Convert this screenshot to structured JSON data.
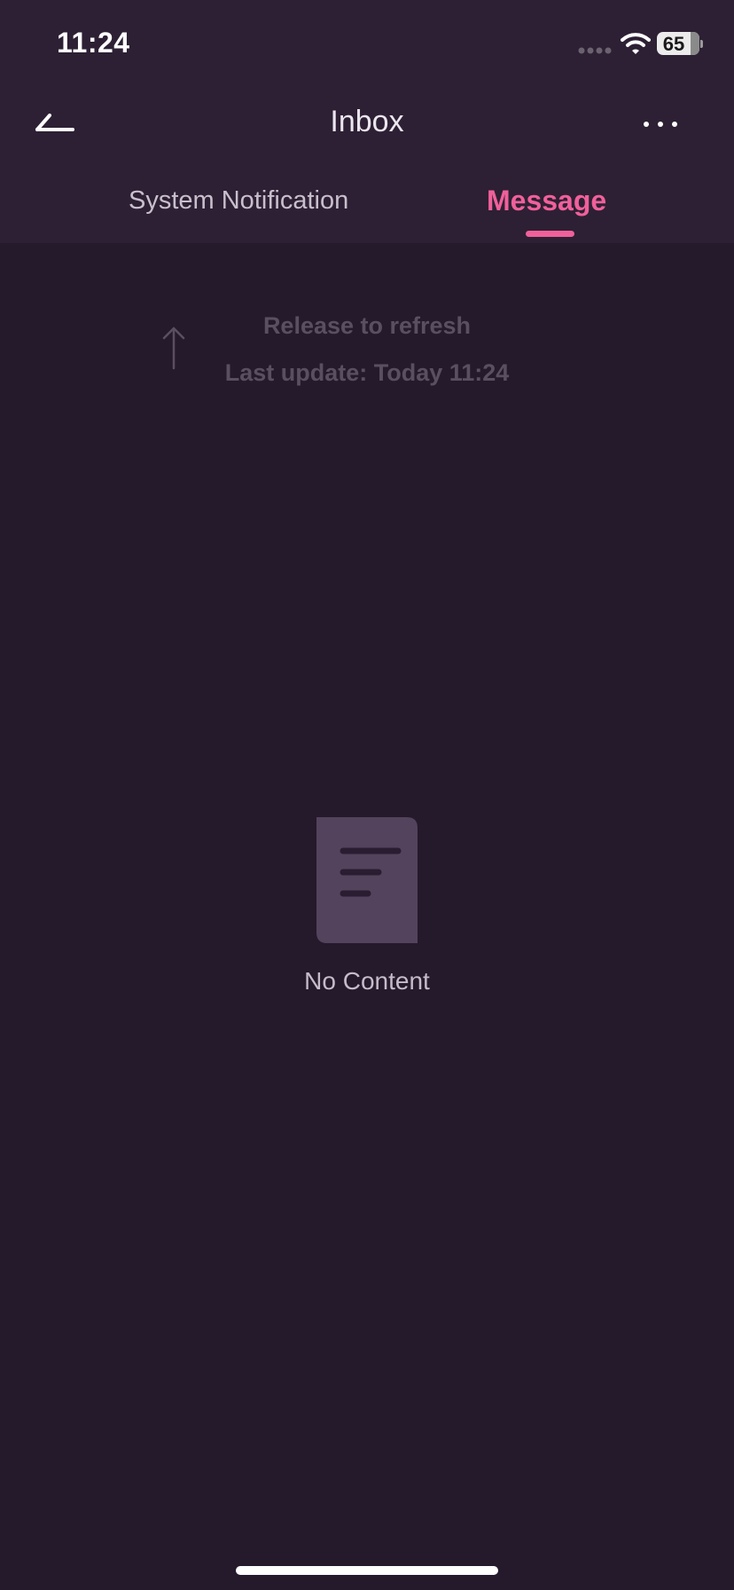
{
  "status_bar": {
    "time": "11:24",
    "battery": "65",
    "icons": [
      "signal-dots-icon",
      "wifi-icon",
      "battery-icon"
    ]
  },
  "nav": {
    "title": "Inbox",
    "back_icon": "back-arrow-icon",
    "more_icon": "more-dots-icon"
  },
  "tabs": [
    {
      "label": "System Notification",
      "active": false
    },
    {
      "label": "Message",
      "active": true
    }
  ],
  "refresh": {
    "title": "Release to refresh",
    "last_update": "Last update: Today 11:24",
    "icon": "arrow-up-icon"
  },
  "empty_state": {
    "icon": "document-icon",
    "label": "No Content"
  },
  "colors": {
    "background": "#25192c",
    "header_background": "#2d2034",
    "accent": "#f0609a",
    "muted_text": "#5a4f60"
  }
}
